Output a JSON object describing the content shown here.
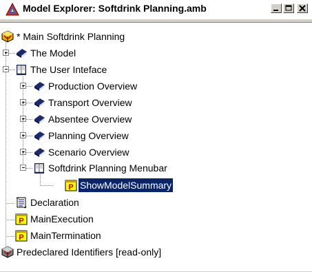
{
  "window": {
    "title": "Model Explorer: Softdrink Planning.amb"
  },
  "tree": {
    "root": {
      "label": "* Main Softdrink Planning",
      "icon": "main-model-icon"
    },
    "items": [
      {
        "label": "The Model",
        "icon": "book-icon",
        "state": "collapsed"
      },
      {
        "label": "The User Inteface",
        "icon": "open-book-icon",
        "state": "expanded"
      },
      {
        "label": "Production Overview",
        "icon": "book-icon",
        "state": "collapsed"
      },
      {
        "label": "Transport Overview",
        "icon": "book-icon",
        "state": "collapsed"
      },
      {
        "label": "Absentee Overview",
        "icon": "book-icon",
        "state": "collapsed"
      },
      {
        "label": "Planning Overview",
        "icon": "book-icon",
        "state": "collapsed"
      },
      {
        "label": "Scenario Overview",
        "icon": "book-icon",
        "state": "collapsed"
      },
      {
        "label": "Softdrink Planning Menubar",
        "icon": "open-book-icon",
        "state": "expanded"
      },
      {
        "label": "ShowModelSummary",
        "icon": "procedure-icon",
        "state": "leaf",
        "selected": true
      },
      {
        "label": "Declaration",
        "icon": "declaration-scroll-icon",
        "state": "leaf"
      },
      {
        "label": "MainExecution",
        "icon": "procedure-icon",
        "state": "leaf"
      },
      {
        "label": "MainTermination",
        "icon": "procedure-icon",
        "state": "leaf"
      },
      {
        "label": "Predeclared Identifiers [read-only]",
        "icon": "predeclared-box-icon",
        "state": "leaf"
      }
    ]
  },
  "colors": {
    "selection": "#0a246a",
    "book": "#1a2a6c",
    "procedure_bg": "#ffff00",
    "procedure_letter": "#c00000"
  }
}
